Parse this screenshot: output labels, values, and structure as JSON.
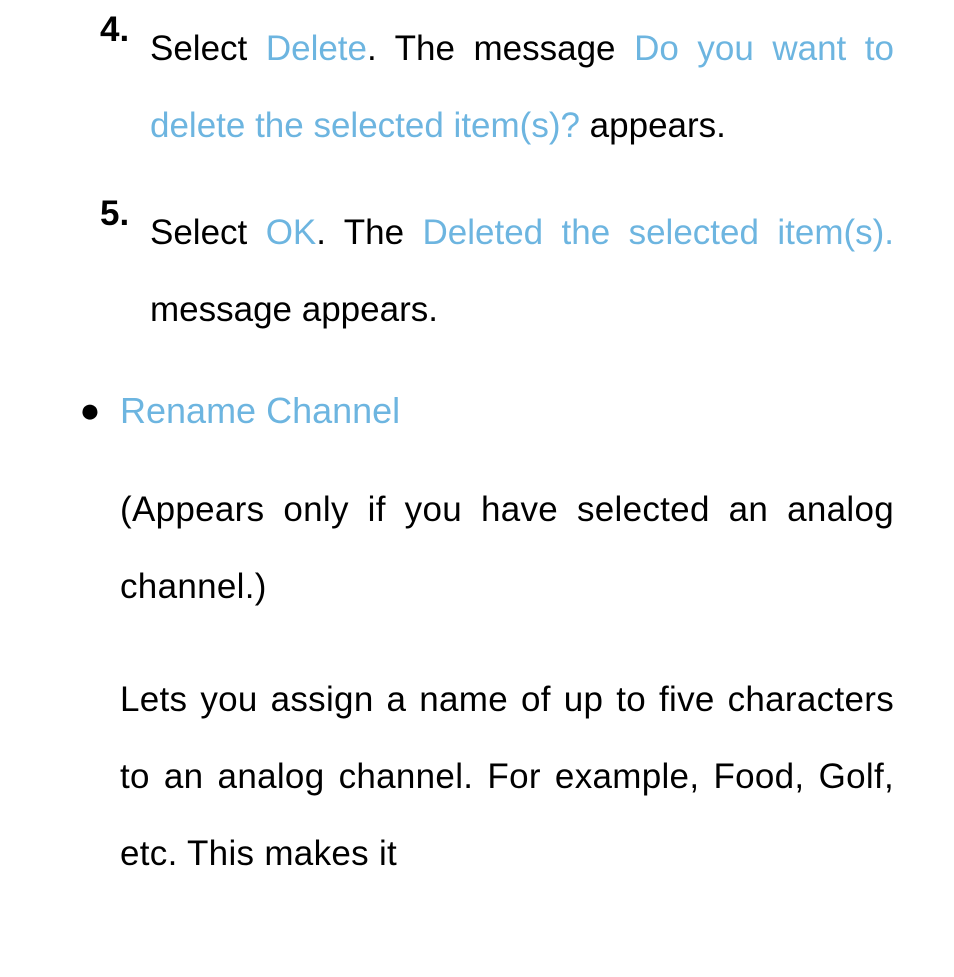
{
  "steps": {
    "s4": {
      "num": "4.",
      "t1": "Select ",
      "delete": "Delete",
      "t2": ". The message ",
      "msg": "Do you want to delete the selected item(s)?",
      "t3": " appears."
    },
    "s5": {
      "num": "5.",
      "t1": "Select ",
      "ok": "OK",
      "t2": ". The ",
      "msg": "Deleted the selected item(s).",
      "t3": " message appears."
    }
  },
  "bullet": {
    "mark": "●",
    "heading": "Rename Channel",
    "para1": "(Appears only if you have selected an analog channel.)",
    "para2": "Lets you assign a name of up to five characters to an analog channel. For example, Food, Golf, etc. This makes it"
  }
}
